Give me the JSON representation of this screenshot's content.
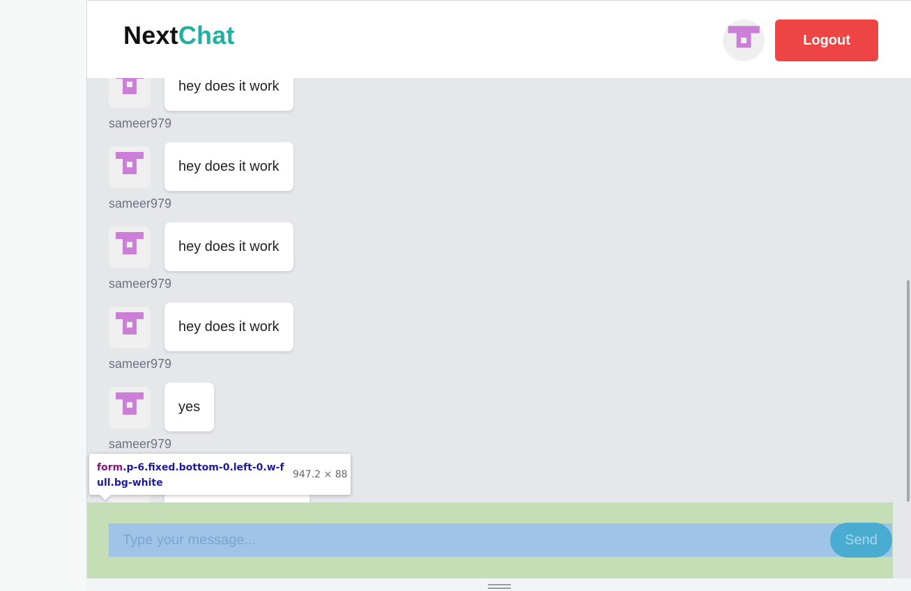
{
  "header": {
    "brand_part1": "Next",
    "brand_part2": "Chat",
    "logout_label": "Logout"
  },
  "messages": [
    {
      "text": "hey does it work",
      "username": "sameer979"
    },
    {
      "text": "hey does it work",
      "username": "sameer979"
    },
    {
      "text": "hey does it work",
      "username": "sameer979"
    },
    {
      "text": "hey does it work",
      "username": "sameer979"
    },
    {
      "text": "yes",
      "username": "sameer979"
    }
  ],
  "composer": {
    "placeholder": "Type your message...",
    "send_label": "Send"
  },
  "devtools_tooltip": {
    "tag": "form",
    "classes": ".p-6.fixed.bottom-0.left-0.w-full.bg-white",
    "size": "947.2 × 88"
  },
  "colors": {
    "brand_accent": "#20b2a0",
    "logout": "#ef4444",
    "avatar_icon": "#cc7fd6",
    "highlight_padding": "#c4dfb6",
    "highlight_content": "#a0c4e8"
  },
  "icons": {
    "user_avatar": "identicon-avatar-icon"
  }
}
